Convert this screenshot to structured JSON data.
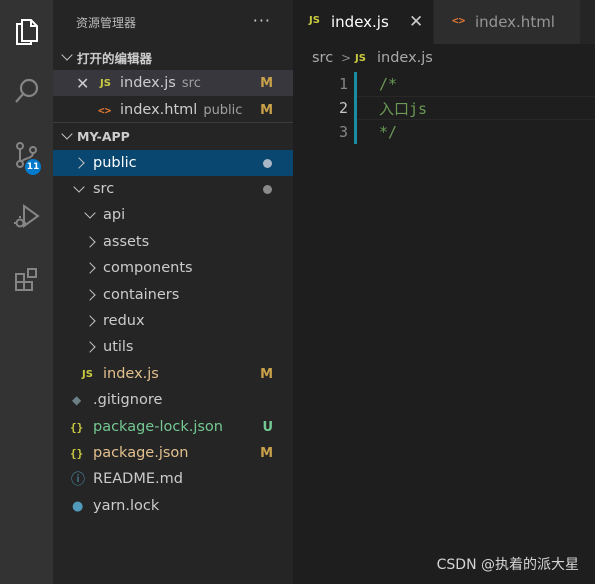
{
  "activity_bar": {
    "items": [
      {
        "name": "explorer-icon"
      },
      {
        "name": "search-icon"
      },
      {
        "name": "source-control-icon",
        "badge": "11"
      },
      {
        "name": "run-debug-icon"
      },
      {
        "name": "extensions-icon"
      }
    ]
  },
  "sidebar": {
    "title": "资源管理器",
    "more": "···",
    "open_editors": {
      "label": "打开的编辑器",
      "items": [
        {
          "label": "index.js",
          "desc": "src",
          "status": "M"
        },
        {
          "label": "index.html",
          "desc": "public",
          "status": "M"
        }
      ]
    },
    "project": {
      "label": "MY-APP",
      "tree": [
        {
          "label": "public"
        },
        {
          "label": "src"
        },
        {
          "label": "api"
        },
        {
          "label": "assets"
        },
        {
          "label": "components"
        },
        {
          "label": "containers"
        },
        {
          "label": "redux"
        },
        {
          "label": "utils"
        },
        {
          "label": "index.js",
          "status": "M"
        },
        {
          "label": ".gitignore"
        },
        {
          "label": "package-lock.json",
          "status": "U"
        },
        {
          "label": "package.json",
          "status": "M"
        },
        {
          "label": "README.md"
        },
        {
          "label": "yarn.lock"
        }
      ]
    }
  },
  "editor": {
    "tabs": [
      {
        "label": "index.js",
        "icon": "JS",
        "close": "✕"
      },
      {
        "label": "index.html",
        "icon": "<>"
      }
    ],
    "breadcrumb": {
      "folder": "src",
      "separator": ">",
      "file": "index.js"
    },
    "lines": [
      {
        "num": "1",
        "text": "/*"
      },
      {
        "num": "2",
        "text": "入口js"
      },
      {
        "num": "3",
        "text": "*/"
      }
    ]
  },
  "watermark": "CSDN @执着的派大星",
  "colors": {
    "accent": "#007acc",
    "modified": "#c9a14a",
    "untracked": "#73c991",
    "comment": "#6a9955",
    "selection": "#094771"
  }
}
